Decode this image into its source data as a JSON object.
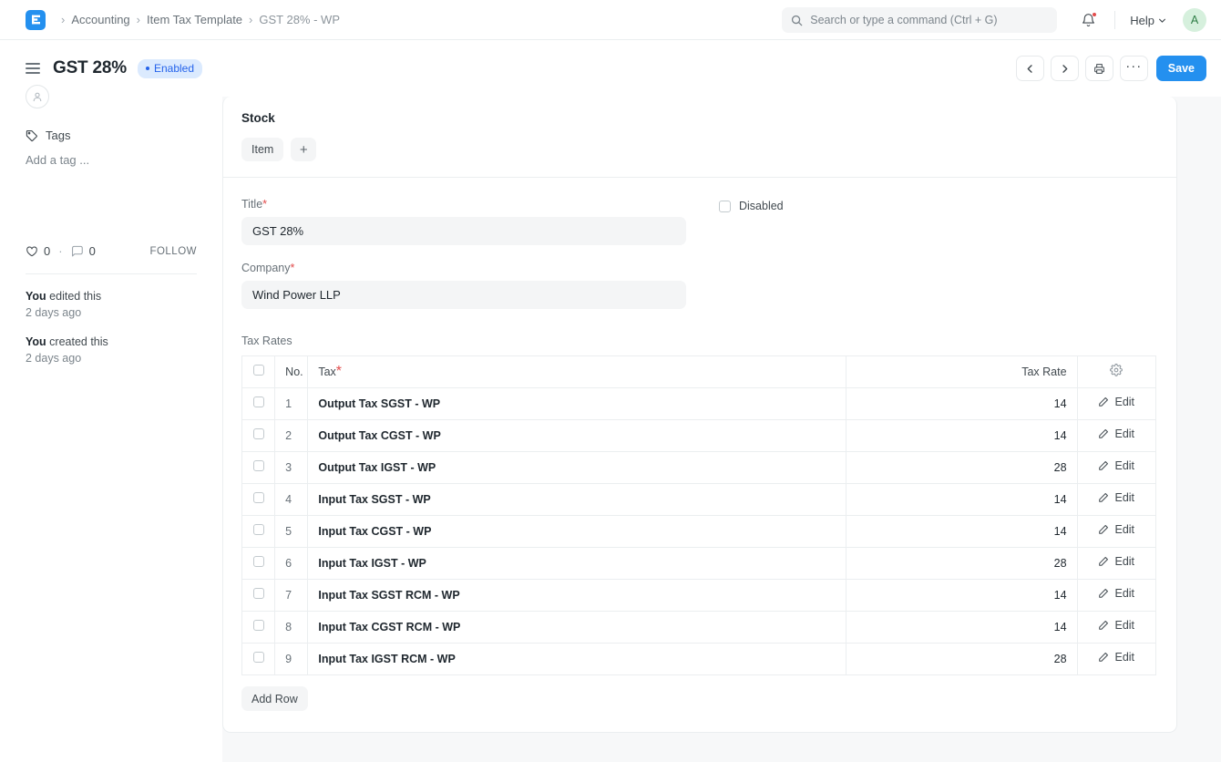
{
  "navbar": {
    "logo_icon": "erpnext-logo-icon",
    "breadcrumbs": [
      {
        "label": "Accounting",
        "current": false
      },
      {
        "label": "Item Tax Template",
        "current": false
      },
      {
        "label": "GST 28% - WP",
        "current": true
      }
    ],
    "separator": "›",
    "search": {
      "icon": "search-icon",
      "placeholder": "Search or type a command (Ctrl + G)",
      "value": ""
    },
    "notifications_icon": "bell-icon",
    "has_notification": true,
    "help_label": "Help",
    "help_chevron_icon": "chevron-down-icon",
    "avatar_initial": "A"
  },
  "page_header": {
    "menu_icon": "hamburger-icon",
    "title": "GST 28%",
    "status": "Enabled",
    "actions": {
      "prev_icon": "chevron-left-icon",
      "next_icon": "chevron-right-icon",
      "print_icon": "printer-icon",
      "more_label": "···",
      "save_label": "Save"
    }
  },
  "sidebar": {
    "assign_placeholder_icon": "avatar-placeholder-icon",
    "tags": {
      "icon": "tag-icon",
      "label": "Tags",
      "add_placeholder": "Add a tag ..."
    },
    "stats": {
      "like_icon": "heart-icon",
      "like_count": "0",
      "separator": "·",
      "comment_icon": "comment-icon",
      "comment_count": "0",
      "follow_label": "FOLLOW"
    },
    "activity": [
      {
        "actor": "You",
        "action": " edited this",
        "time": "2 days ago"
      },
      {
        "actor": "You",
        "action": " created this",
        "time": "2 days ago"
      }
    ]
  },
  "main": {
    "stock_section": {
      "title": "Stock",
      "chips": [
        {
          "label": "Item",
          "icon": null
        },
        {
          "label": "+",
          "icon": "plus-icon"
        }
      ]
    },
    "form": {
      "title_field": {
        "label": "Title",
        "required": "*",
        "value": "GST 28%"
      },
      "company_field": {
        "label": "Company",
        "required": "*",
        "value": "Wind Power LLP"
      },
      "disabled_checkbox": {
        "label": "Disabled",
        "checked": false
      }
    },
    "tax_rates": {
      "section_label": "Tax Rates",
      "columns": {
        "no": "No.",
        "tax": "Tax",
        "tax_required": "*",
        "tax_rate": "Tax Rate",
        "settings_icon": "gear-icon"
      },
      "edit_label": "Edit",
      "edit_icon": "pencil-icon",
      "add_row_label": "Add Row",
      "rows": [
        {
          "no": "1",
          "tax": "Output Tax SGST - WP",
          "rate": "14"
        },
        {
          "no": "2",
          "tax": "Output Tax CGST - WP",
          "rate": "14"
        },
        {
          "no": "3",
          "tax": "Output Tax IGST - WP",
          "rate": "28"
        },
        {
          "no": "4",
          "tax": "Input Tax SGST - WP",
          "rate": "14"
        },
        {
          "no": "5",
          "tax": "Input Tax CGST - WP",
          "rate": "14"
        },
        {
          "no": "6",
          "tax": "Input Tax IGST - WP",
          "rate": "28"
        },
        {
          "no": "7",
          "tax": "Input Tax SGST RCM - WP",
          "rate": "14"
        },
        {
          "no": "8",
          "tax": "Input Tax CGST RCM - WP",
          "rate": "14"
        },
        {
          "no": "9",
          "tax": "Input Tax IGST RCM - WP",
          "rate": "28"
        }
      ]
    }
  },
  "colors": {
    "accent": "#2490ef",
    "badge_bg": "#dbeafe",
    "badge_text": "#2563eb",
    "required": "#e24c4c",
    "page_bg": "#f7f8f9",
    "border": "#ebeef0"
  }
}
